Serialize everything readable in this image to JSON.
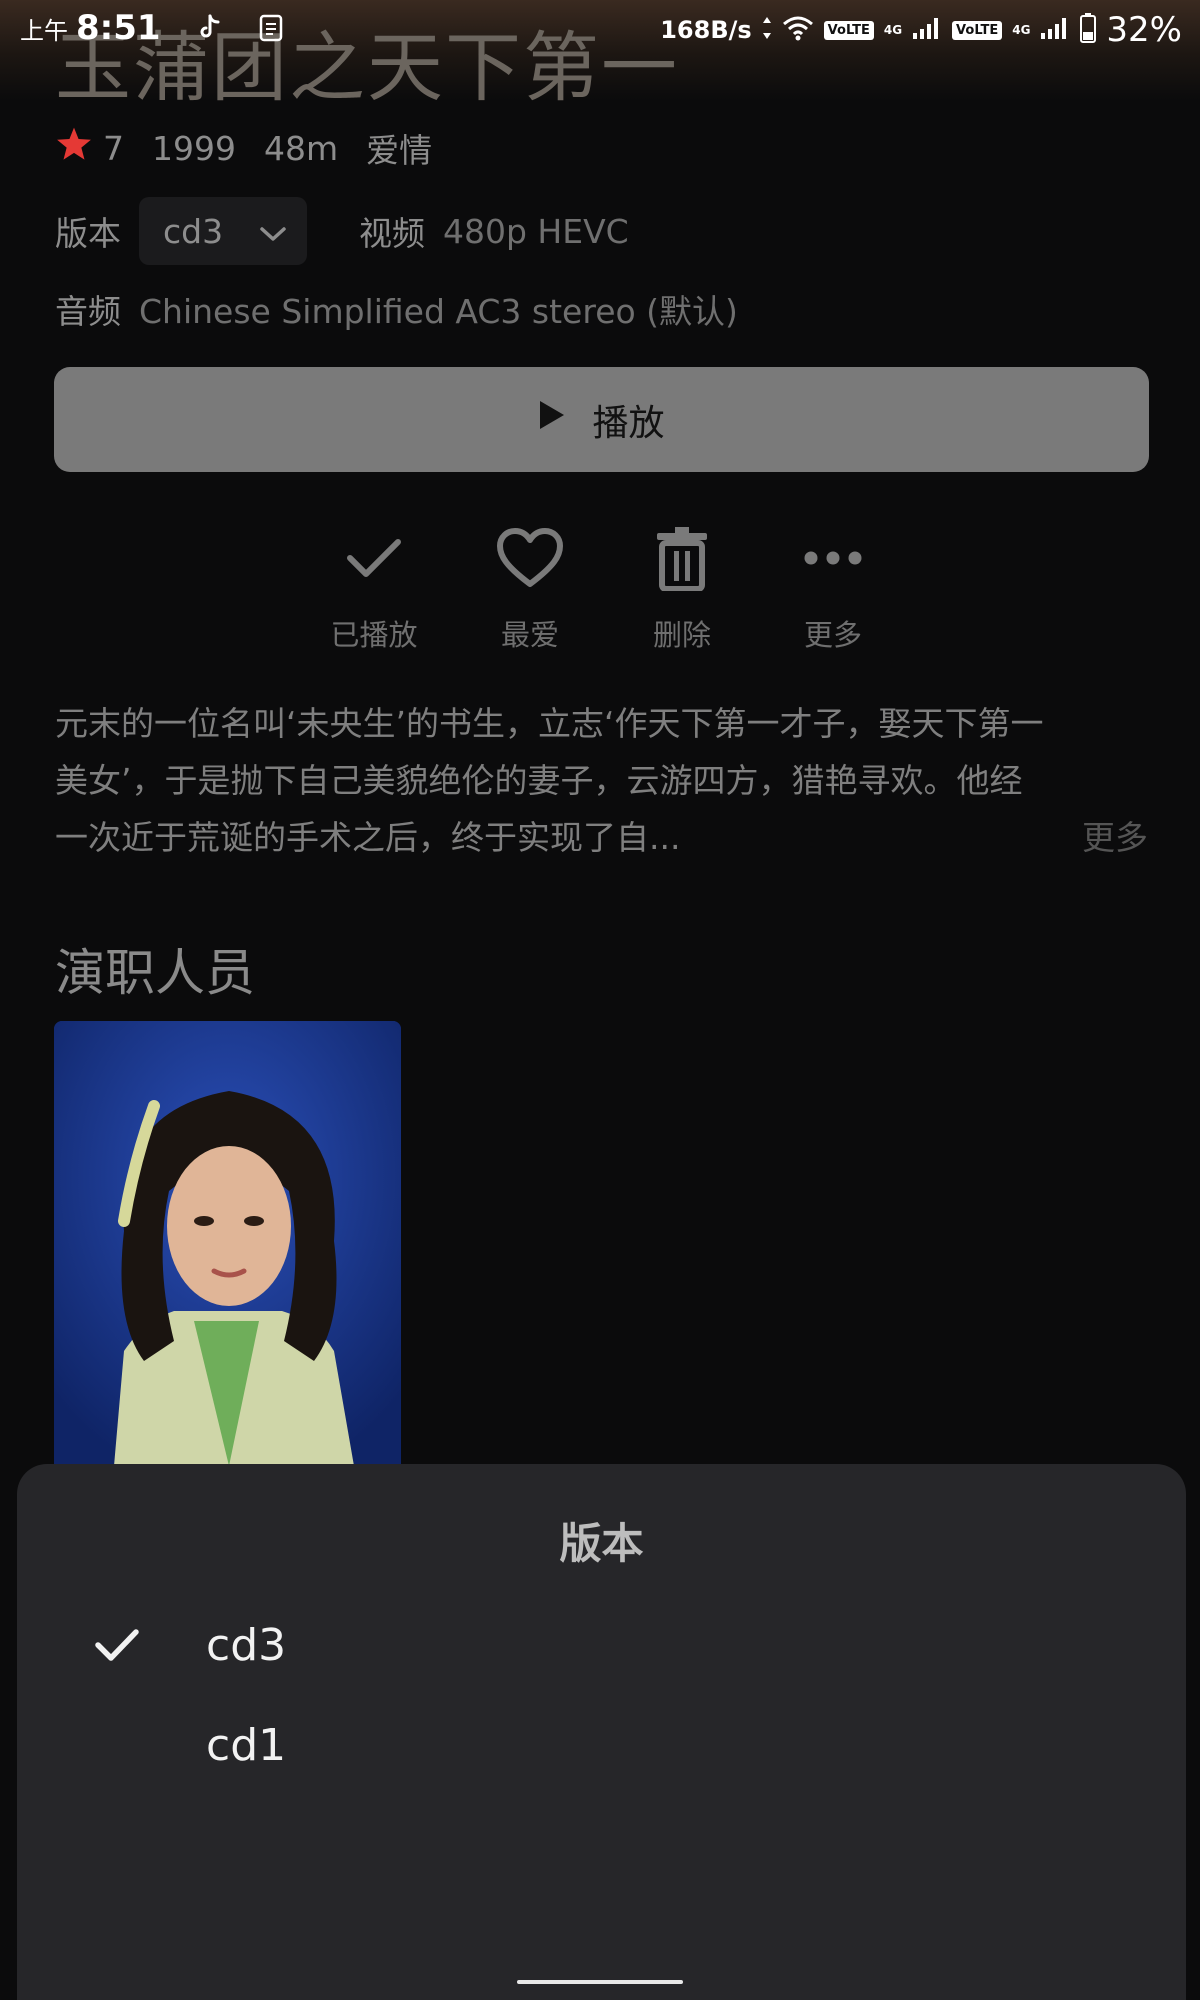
{
  "status_bar": {
    "ampm": "上午",
    "time": "8:51",
    "net_speed": "168B/s",
    "volte_1": "VoLTE",
    "net_1": "4G",
    "volte_2": "VoLTE",
    "net_2": "4G",
    "battery": "32%"
  },
  "item": {
    "title": "玉蒲团之天下第一",
    "rating": "7",
    "year": "1999",
    "runtime": "48m",
    "genre": "爱情",
    "version_label": "版本",
    "version_value": "cd3",
    "video_label": "视频",
    "video_value": "480p HEVC",
    "audio_label": "音频",
    "audio_value": "Chinese Simplified AC3 stereo (默认)",
    "rating_color": "#e53935"
  },
  "play_button": {
    "label": "播放"
  },
  "actions": [
    {
      "label": "已播放",
      "icon": "check-icon"
    },
    {
      "label": "最爱",
      "icon": "heart-icon"
    },
    {
      "label": "删除",
      "icon": "trash-icon"
    },
    {
      "label": "更多",
      "icon": "more-icon"
    }
  ],
  "overview": {
    "text": "元末的一位名叫‘未央生’的书生，立志‘作天下第一才子，娶天下第一美女’，于是抛下自己美貌绝伦的妻子，云游四方，猎艳寻欢。他经一次近于荒诞的手术之后，终于实现了自...",
    "more": "更多"
  },
  "cast": {
    "heading": "演职人员"
  },
  "version_sheet": {
    "title": "版本",
    "options": [
      {
        "label": "cd3",
        "selected": true
      },
      {
        "label": "cd1",
        "selected": false
      }
    ]
  }
}
